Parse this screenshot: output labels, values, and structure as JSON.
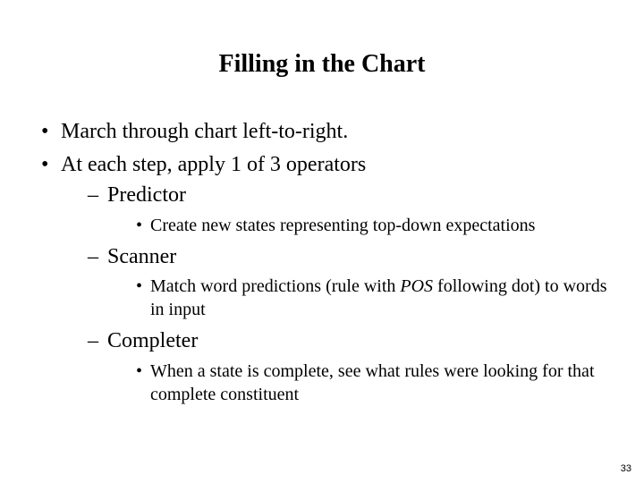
{
  "title": "Filling in the Chart",
  "bullets": {
    "b1": "March through chart left-to-right.",
    "b2": "At each step, apply 1 of 3 operators",
    "op1": {
      "name": "Predictor",
      "desc": "Create new states representing top-down expectations"
    },
    "op2": {
      "name": "Scanner",
      "desc_pre": "Match word predictions (rule with ",
      "desc_em": "POS",
      "desc_post": " following dot) to words in input"
    },
    "op3": {
      "name": "Completer",
      "desc": "When a state is complete, see what rules were looking for that complete constituent"
    }
  },
  "page_number": "33"
}
